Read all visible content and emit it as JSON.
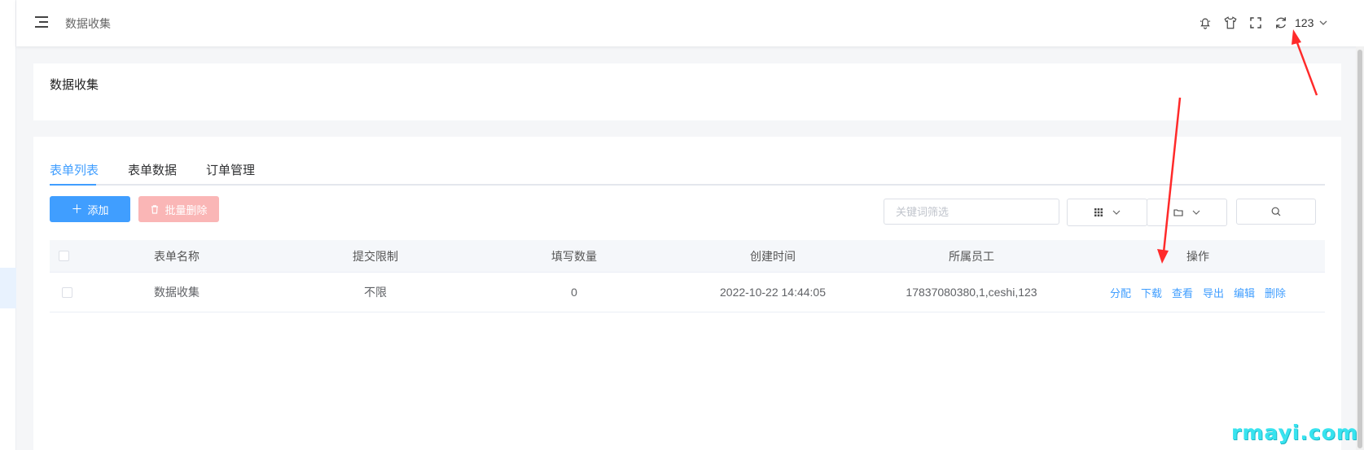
{
  "header": {
    "breadcrumb": "数据收集",
    "icons": [
      "bell-icon",
      "shirt-icon",
      "fullscreen-icon",
      "refresh-icon"
    ],
    "user_name": "123"
  },
  "page_title": "数据收集",
  "tabs": [
    {
      "label": "表单列表",
      "active": true
    },
    {
      "label": "表单数据",
      "active": false
    },
    {
      "label": "订单管理",
      "active": false
    }
  ],
  "toolbar": {
    "add_label": "添加",
    "batch_delete_label": "批量删除",
    "search_placeholder": "关键词筛选"
  },
  "table": {
    "columns": [
      "表单名称",
      "提交限制",
      "填写数量",
      "创建时间",
      "所属员工",
      "操作"
    ],
    "rows": [
      {
        "name": "数据收集",
        "limit": "不限",
        "count": "0",
        "created": "2022-10-22 14:44:05",
        "staff": "17837080380,1,ceshi,123",
        "actions": [
          "分配",
          "下载",
          "查看",
          "导出",
          "编辑",
          "删除"
        ]
      }
    ]
  },
  "watermark": "rmayi.com",
  "colors": {
    "primary": "#409eff",
    "danger_light": "#fab6b6",
    "annotation": "#ff2a2a",
    "watermark": "#38e3ef"
  }
}
